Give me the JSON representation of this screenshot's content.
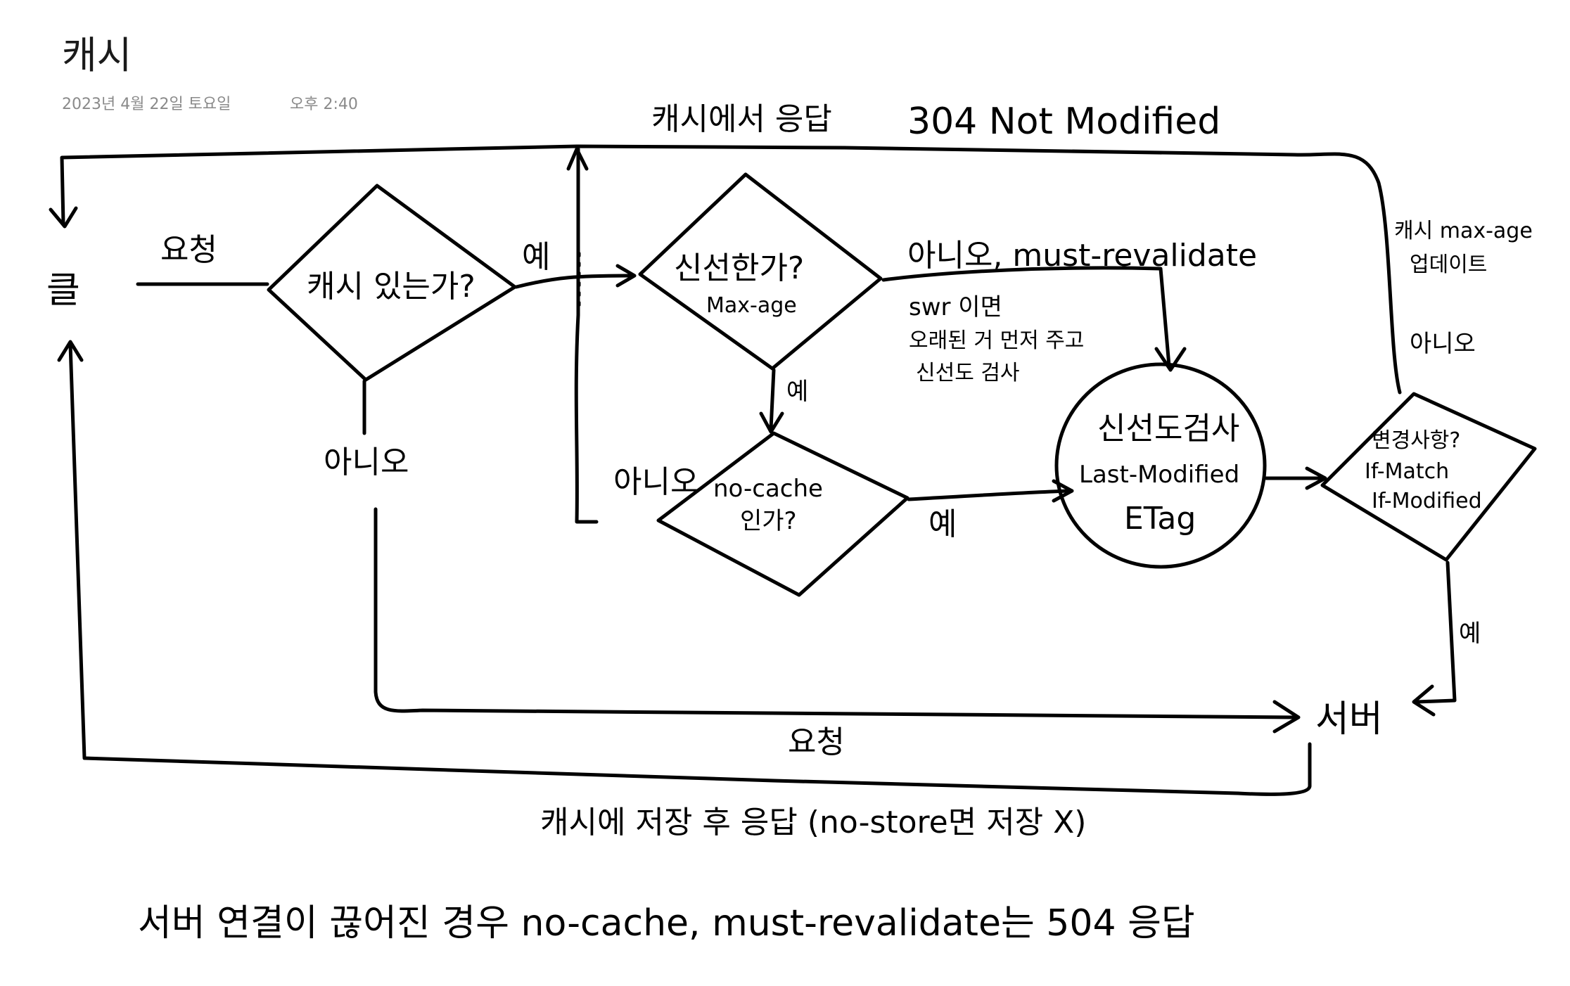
{
  "note": {
    "title": "캐시",
    "date": "2023년 4월 22일 토요일",
    "time": "오후 2:40"
  },
  "diagram": {
    "client": "클",
    "server": "서버",
    "request_label": "요청",
    "cache_exists": "캐시 있는가?",
    "fresh_q": "신선한가?",
    "fresh_sub": "Max-age",
    "nocache_q": "no-cache",
    "nocache_q2": "인가?",
    "yes": "예",
    "no": "아니오",
    "no_must_revalidate": "아니오, must-revalidate",
    "swr_line1": "swr 이면",
    "swr_line2": "오래된 거 먼저 주고",
    "swr_line3": "신선도 검사",
    "check_line1": "신선도검사",
    "check_line2": "Last-Modified",
    "check_line3": "ETag",
    "changed_q": "변경사항?",
    "changed_q2": "If-Match",
    "changed_q3": "If-Modified",
    "cache_update1": "캐시 max-age",
    "cache_update2": "업데이트",
    "top_response": "캐시에서 응답",
    "top_304": "304 Not Modified",
    "bottom_request": "요청",
    "bottom_store": "캐시에 저장 후 응답 (no-store면 저장 X)",
    "footnote": "서버 연결이 끊어진 경우 no-cache, must-revalidate는 504 응답"
  }
}
